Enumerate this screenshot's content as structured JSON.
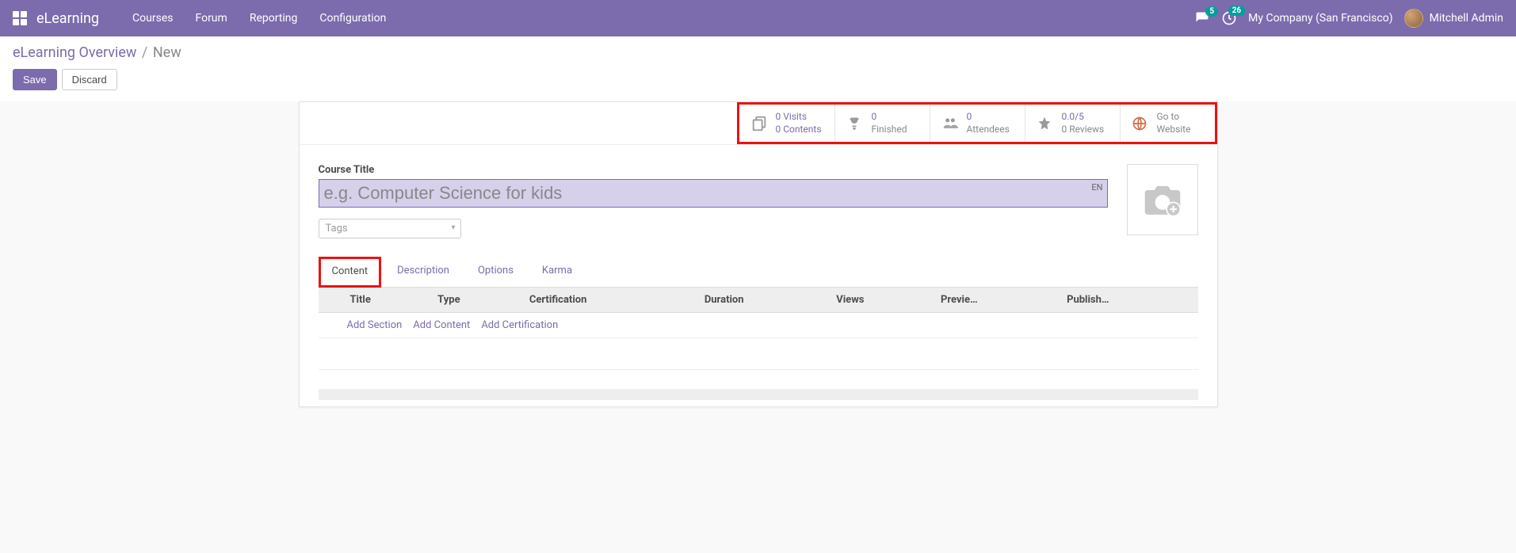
{
  "navbar": {
    "brand": "eLearning",
    "links": [
      "Courses",
      "Forum",
      "Reporting",
      "Configuration"
    ],
    "chat_count": "5",
    "activity_count": "26",
    "company": "My Company (San Francisco)",
    "user": "Mitchell Admin"
  },
  "breadcrumb": {
    "root": "eLearning Overview",
    "current": "New"
  },
  "actions": {
    "save": "Save",
    "discard": "Discard"
  },
  "stats": {
    "visits_line1": "0 Visits",
    "visits_line2": "0 Contents",
    "finished_count": "0",
    "finished_label": "Finished",
    "attendees_count": "0",
    "attendees_label": "Attendees",
    "rating_value": "0.0/5",
    "rating_label": "0 Reviews",
    "goto_line1": "Go to",
    "goto_line2": "Website"
  },
  "form": {
    "title_label": "Course Title",
    "title_placeholder": "e.g. Computer Science for kids",
    "title_value": "",
    "lang": "EN",
    "tags_placeholder": "Tags"
  },
  "tabs": [
    "Content",
    "Description",
    "Options",
    "Karma"
  ],
  "active_tab": "Content",
  "table": {
    "columns": [
      "Title",
      "Type",
      "Certification",
      "Duration",
      "Views",
      "Previe…",
      "Publish…"
    ],
    "add_section": "Add Section",
    "add_content": "Add Content",
    "add_cert": "Add Certification"
  }
}
